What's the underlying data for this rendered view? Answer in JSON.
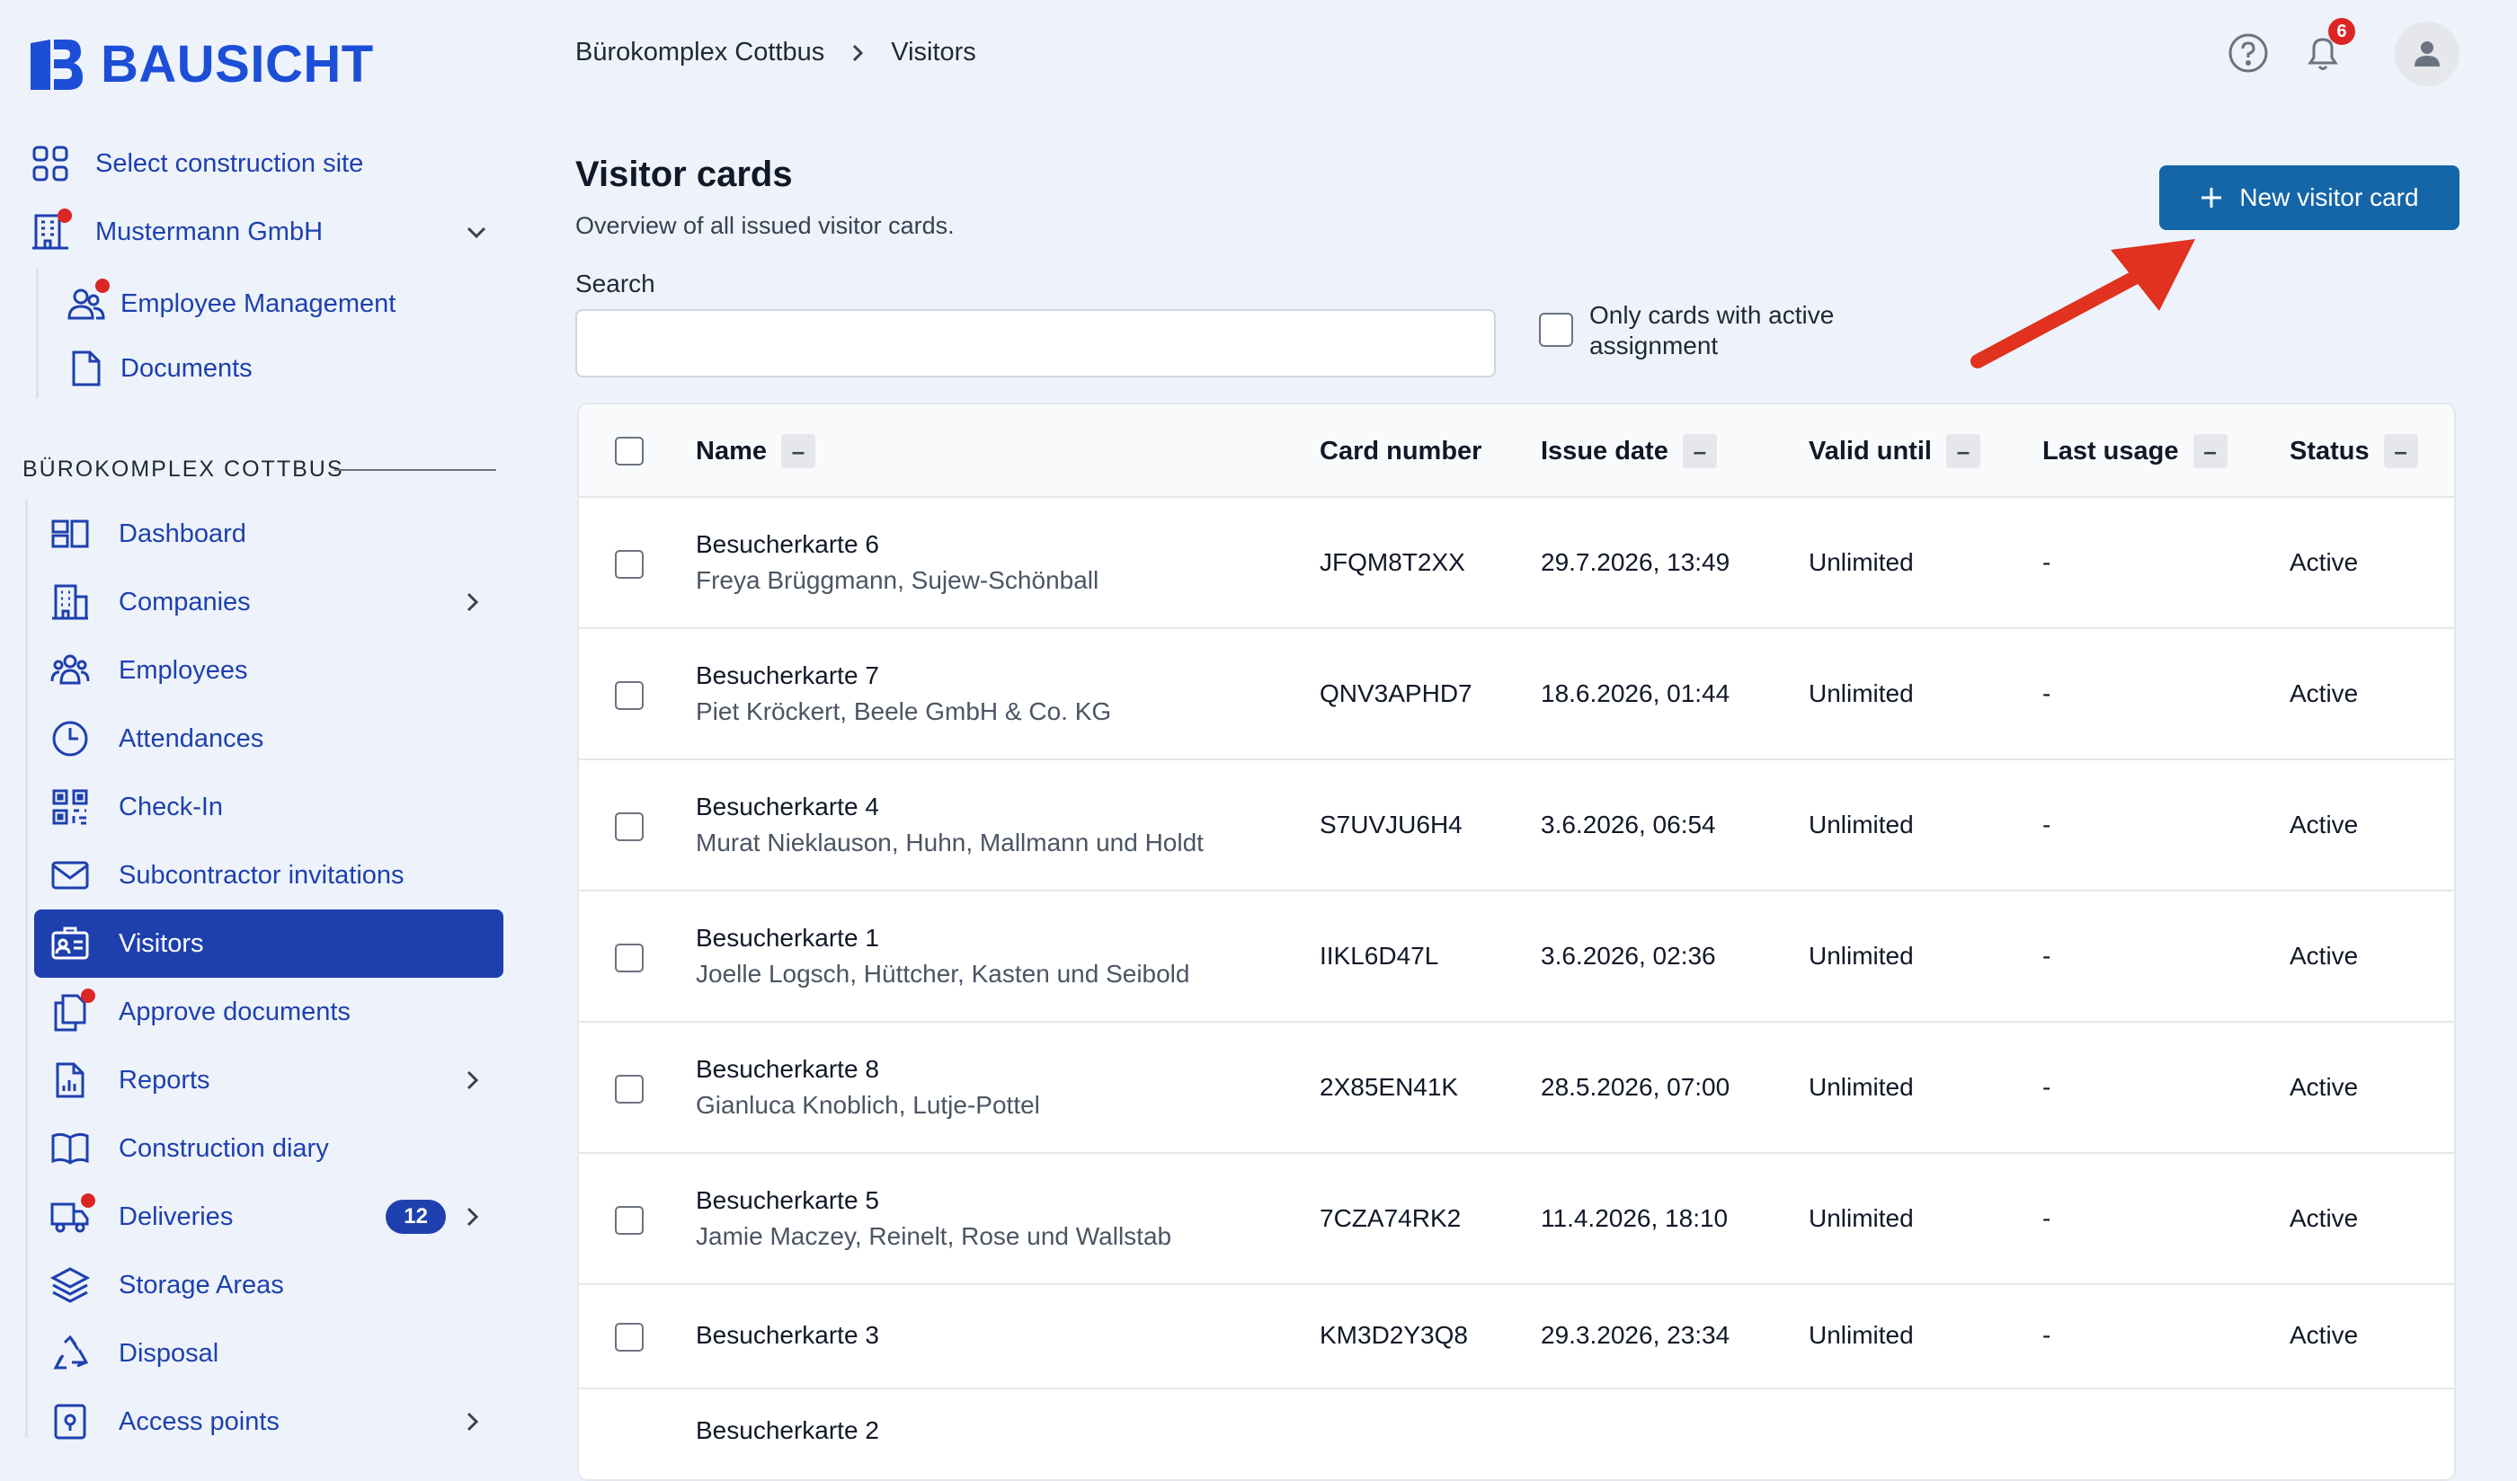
{
  "app": {
    "brand": "BAUSICHT",
    "accent": "#1e40af",
    "primary_button": "#1566a8"
  },
  "sidebar": {
    "select_site": "Select construction site",
    "company": "Mustermann GmbH",
    "company_items": [
      {
        "label": "Employee Management",
        "icon": "users-icon",
        "dot": true
      },
      {
        "label": "Documents",
        "icon": "document-icon",
        "dot": false
      }
    ],
    "section_title": "BÜROKOMPLEX COTTBUS",
    "nav": [
      {
        "label": "Dashboard",
        "icon": "dashboard-icon"
      },
      {
        "label": "Companies",
        "icon": "building-icon",
        "chevron": true
      },
      {
        "label": "Employees",
        "icon": "employees-icon"
      },
      {
        "label": "Attendances",
        "icon": "clock-icon"
      },
      {
        "label": "Check-In",
        "icon": "qr-code-icon"
      },
      {
        "label": "Subcontractor invitations",
        "icon": "envelope-icon"
      },
      {
        "label": "Visitors",
        "icon": "visitor-badge-icon",
        "active": true
      },
      {
        "label": "Approve documents",
        "icon": "documents-stack-icon",
        "dot": true
      },
      {
        "label": "Reports",
        "icon": "report-icon",
        "chevron": true
      },
      {
        "label": "Construction diary",
        "icon": "book-icon"
      },
      {
        "label": "Deliveries",
        "icon": "truck-icon",
        "dot": true,
        "badge": "12",
        "chevron": true
      },
      {
        "label": "Storage Areas",
        "icon": "layers-icon"
      },
      {
        "label": "Disposal",
        "icon": "recycle-icon"
      },
      {
        "label": "Access points",
        "icon": "access-point-icon",
        "chevron": true
      }
    ]
  },
  "header": {
    "breadcrumb": [
      "Bürokomplex Cottbus",
      "Visitors"
    ],
    "notifications": "6"
  },
  "page": {
    "title": "Visitor cards",
    "subtitle": "Overview of all issued visitor cards.",
    "new_button": "New visitor card",
    "search_label": "Search",
    "search_value": "",
    "filter_label": "Only cards with active assignment"
  },
  "table": {
    "columns": [
      "Name",
      "Card number",
      "Issue date",
      "Valid until",
      "Last usage",
      "Status"
    ],
    "sort_symbol": "–",
    "rows": [
      {
        "name": "Besucherkarte 6",
        "holder": "Freya Brüggmann, Sujew-Schönball",
        "card": "JFQM8T2XX",
        "issued": "29.7.2026, 13:49",
        "valid": "Unlimited",
        "last": "-",
        "status": "Active"
      },
      {
        "name": "Besucherkarte 7",
        "holder": "Piet Kröckert, Beele GmbH & Co. KG",
        "card": "QNV3APHD7",
        "issued": "18.6.2026, 01:44",
        "valid": "Unlimited",
        "last": "-",
        "status": "Active"
      },
      {
        "name": "Besucherkarte 4",
        "holder": "Murat Nieklauson, Huhn, Mallmann und Holdt",
        "card": "S7UVJU6H4",
        "issued": "3.6.2026, 06:54",
        "valid": "Unlimited",
        "last": "-",
        "status": "Active"
      },
      {
        "name": "Besucherkarte 1",
        "holder": "Joelle Logsch, Hüttcher, Kasten und Seibold",
        "card": "IIKL6D47L",
        "issued": "3.6.2026, 02:36",
        "valid": "Unlimited",
        "last": "-",
        "status": "Active"
      },
      {
        "name": "Besucherkarte 8",
        "holder": "Gianluca Knoblich, Lutje-Pottel",
        "card": "2X85EN41K",
        "issued": "28.5.2026, 07:00",
        "valid": "Unlimited",
        "last": "-",
        "status": "Active"
      },
      {
        "name": "Besucherkarte 5",
        "holder": "Jamie Maczey, Reinelt, Rose und Wallstab",
        "card": "7CZA74RK2",
        "issued": "11.4.2026, 18:10",
        "valid": "Unlimited",
        "last": "-",
        "status": "Active"
      },
      {
        "name": "Besucherkarte 3",
        "holder": "",
        "card": "KM3D2Y3Q8",
        "issued": "29.3.2026, 23:34",
        "valid": "Unlimited",
        "last": "-",
        "status": "Active"
      },
      {
        "name": "Besucherkarte 2",
        "holder": "",
        "card": "",
        "issued": "",
        "valid": "",
        "last": "",
        "status": ""
      }
    ]
  }
}
